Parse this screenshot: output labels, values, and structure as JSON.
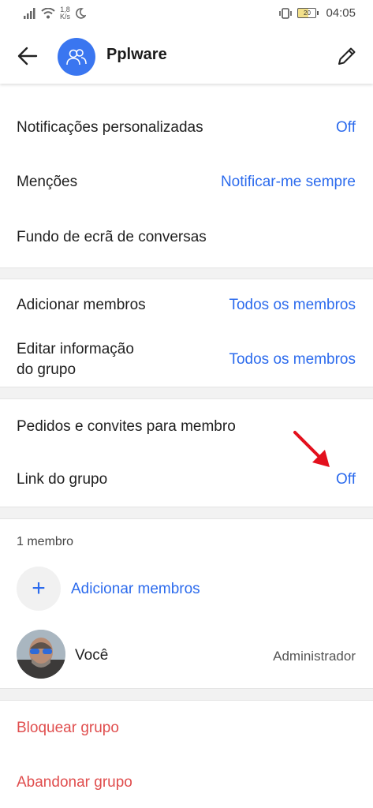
{
  "status_bar": {
    "net_speed_value": "1,8",
    "net_speed_unit": "K/s",
    "battery": "20",
    "time": "04:05"
  },
  "header": {
    "title": "Pplware",
    "back_icon": "arrow-left-icon",
    "edit_icon": "pencil-icon",
    "avatar_icon": "group-icon",
    "avatar_color": "#3a76f0"
  },
  "section1": [
    {
      "label": "Notificações personalizadas",
      "value": "Off"
    },
    {
      "label": "Menções",
      "value": "Notificar-me sempre"
    },
    {
      "label": "Fundo de ecrã de conversas",
      "value": ""
    }
  ],
  "section2": [
    {
      "label": "Adicionar membros",
      "value": "Todos os membros"
    },
    {
      "label_line1": "Editar informação",
      "label_line2": "do grupo",
      "value": "Todos os membros"
    }
  ],
  "section3": [
    {
      "label": "Pedidos e convites para membro",
      "value": ""
    },
    {
      "label": "Link do grupo",
      "value": "Off"
    }
  ],
  "members": {
    "count_label": "1 membro",
    "add_label": "Adicionar membros",
    "add_icon": "plus-icon",
    "list": [
      {
        "name": "Você",
        "role": "Administrador"
      }
    ]
  },
  "actions": {
    "block": "Bloquear grupo",
    "leave": "Abandonar grupo"
  },
  "colors": {
    "accent": "#2c6bed",
    "danger": "#e04e4e",
    "annotation_arrow": "#e3101d"
  }
}
